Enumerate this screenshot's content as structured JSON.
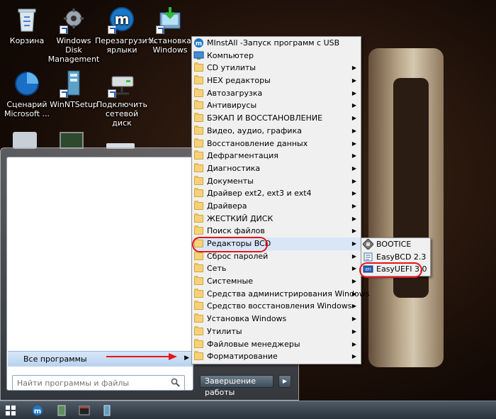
{
  "desktop": {
    "icons": [
      {
        "label": "Корзина"
      },
      {
        "label": "Windows Disk Management"
      },
      {
        "label": "Перезагрузить ярлыки"
      },
      {
        "label": "Установка Windows"
      },
      {
        "label": "Сценарий Microsoft ..."
      },
      {
        "label": "WinNTSetup"
      },
      {
        "label": "Подключить сетевой диск"
      }
    ]
  },
  "start_menu": {
    "all_programs_label": "Все программы",
    "search_placeholder": "Найти программы и файлы",
    "shutdown_label": "Завершение работы"
  },
  "programs_menu": {
    "items": [
      {
        "label": "MInstAll -Запуск программ с USB",
        "icon": "minstall-icon",
        "submenu": false
      },
      {
        "label": "Компьютер",
        "icon": "computer-icon",
        "submenu": false
      },
      {
        "label": "CD утилиты",
        "icon": "folder-icon",
        "submenu": true
      },
      {
        "label": "HEX редакторы",
        "icon": "folder-icon",
        "submenu": true
      },
      {
        "label": "Автозагрузка",
        "icon": "folder-icon",
        "submenu": true
      },
      {
        "label": "Антивирусы",
        "icon": "folder-icon",
        "submenu": true
      },
      {
        "label": "БЭКАП И ВОССТАНОВЛЕНИЕ",
        "icon": "folder-icon",
        "submenu": true
      },
      {
        "label": "Видео, аудио, графика",
        "icon": "folder-icon",
        "submenu": true
      },
      {
        "label": "Восстановление данных",
        "icon": "folder-icon",
        "submenu": true
      },
      {
        "label": "Дефрагментация",
        "icon": "folder-icon",
        "submenu": true
      },
      {
        "label": "Диагностика",
        "icon": "folder-icon",
        "submenu": true
      },
      {
        "label": "Документы",
        "icon": "folder-icon",
        "submenu": true
      },
      {
        "label": "Драйвер ext2, ext3 и ext4",
        "icon": "folder-icon",
        "submenu": true
      },
      {
        "label": "Драйвера",
        "icon": "folder-icon",
        "submenu": true
      },
      {
        "label": "ЖЕСТКИЙ ДИСК",
        "icon": "folder-icon",
        "submenu": true
      },
      {
        "label": "Поиск файлов",
        "icon": "folder-icon",
        "submenu": true
      },
      {
        "label": "Редакторы BCD",
        "icon": "folder-icon",
        "submenu": true
      },
      {
        "label": "Сброс паролей",
        "icon": "folder-icon",
        "submenu": true
      },
      {
        "label": "Сеть",
        "icon": "folder-icon",
        "submenu": true
      },
      {
        "label": "Системные",
        "icon": "folder-icon",
        "submenu": true
      },
      {
        "label": "Средства администрирования Windows",
        "icon": "folder-icon",
        "submenu": true
      },
      {
        "label": "Средство восстановления Windows",
        "icon": "folder-icon",
        "submenu": true
      },
      {
        "label": "Установка Windows",
        "icon": "folder-icon",
        "submenu": true
      },
      {
        "label": "Утилиты",
        "icon": "folder-icon",
        "submenu": true
      },
      {
        "label": "Файловые менеджеры",
        "icon": "folder-icon",
        "submenu": true
      },
      {
        "label": "Форматирование",
        "icon": "folder-icon",
        "submenu": true
      }
    ]
  },
  "bcd_submenu": {
    "items": [
      {
        "label": "BOOTICE"
      },
      {
        "label": "EasyBCD 2.3"
      },
      {
        "label": "EasyUEFI 3.0"
      }
    ]
  },
  "colors": {
    "annotation": "#e8141c",
    "menu_bg": "#f0f0f0",
    "highlight": "#d8e6f7"
  }
}
